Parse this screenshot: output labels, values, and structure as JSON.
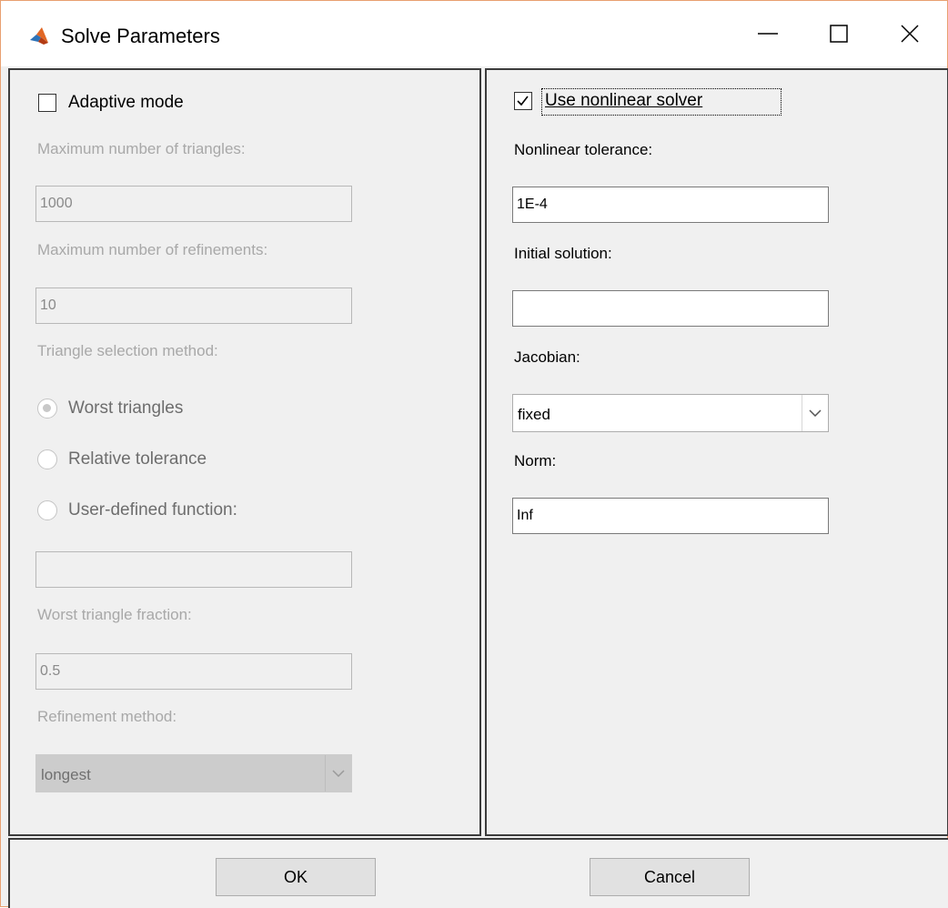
{
  "window": {
    "title": "Solve Parameters",
    "icons": {
      "app": "matlab-logo-icon",
      "minimize": "minimize-icon",
      "maximize": "maximize-icon",
      "close": "close-icon"
    }
  },
  "left_panel": {
    "adaptive_mode": {
      "label": "Adaptive mode",
      "checked": false
    },
    "max_triangles": {
      "label": "Maximum number of triangles:",
      "value": "1000"
    },
    "max_refinements": {
      "label": "Maximum number of refinements:",
      "value": "10"
    },
    "triangle_selection": {
      "label": "Triangle selection method:",
      "options": [
        "Worst triangles",
        "Relative tolerance",
        "User-defined function:"
      ],
      "selected": "Worst triangles"
    },
    "user_function": {
      "value": ""
    },
    "worst_fraction": {
      "label": "Worst triangle fraction:",
      "value": "0.5"
    },
    "refinement_method": {
      "label": "Refinement method:",
      "value": "longest"
    }
  },
  "right_panel": {
    "nonlinear": {
      "label": "Use nonlinear solver",
      "checked": true
    },
    "tolerance": {
      "label": "Nonlinear tolerance:",
      "value": "1E-4"
    },
    "initial_solution": {
      "label": "Initial solution:",
      "value": ""
    },
    "jacobian": {
      "label": "Jacobian:",
      "value": "fixed"
    },
    "norm": {
      "label": "Norm:",
      "value": "Inf"
    }
  },
  "buttons": {
    "ok": "OK",
    "cancel": "Cancel"
  },
  "colors": {
    "window_border": "#e8a070",
    "panel_bg": "#f0f0f0",
    "disabled_text": "#a8a8a8",
    "button_bg": "#e1e1e1"
  }
}
